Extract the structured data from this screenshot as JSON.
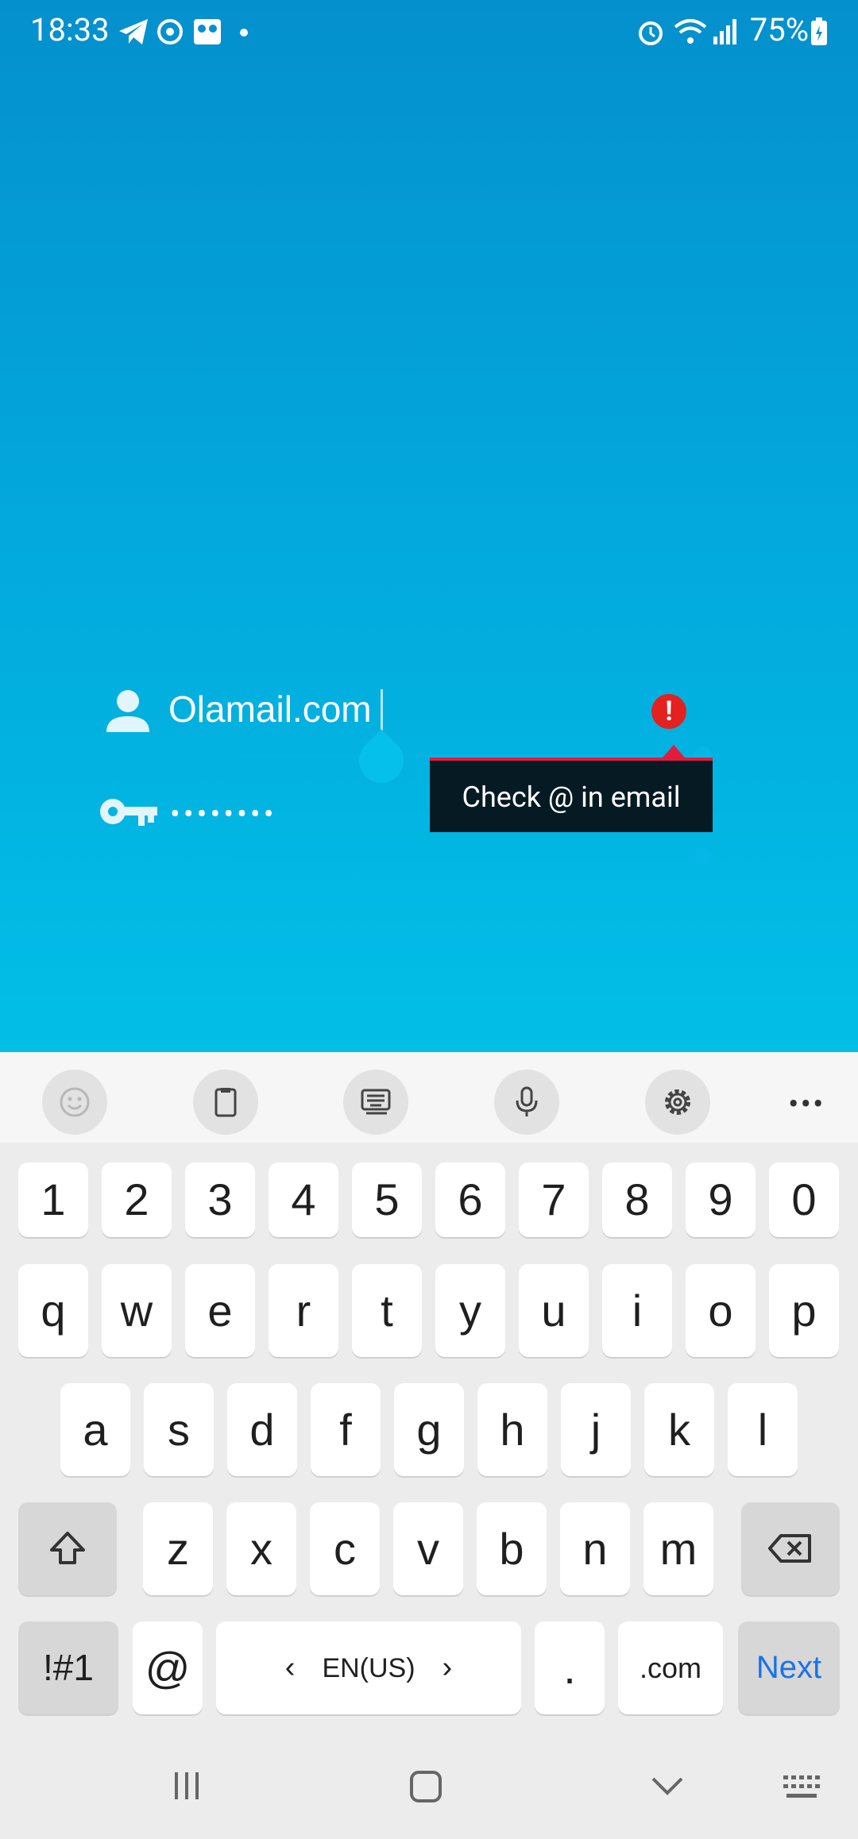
{
  "status_bar": {
    "time": "18:33",
    "battery": "75%"
  },
  "login": {
    "email_value": "Olamail.com",
    "password_dots": "••••••••",
    "error_tooltip": "Check @ in email"
  },
  "keyboard": {
    "toolbar": [
      "emoji-icon",
      "clipboard-icon",
      "keyboard-mode-icon",
      "microphone-icon",
      "gear-icon",
      "more-icon"
    ],
    "more_label": "•••",
    "number_row": [
      "1",
      "2",
      "3",
      "4",
      "5",
      "6",
      "7",
      "8",
      "9",
      "0"
    ],
    "row1": [
      "q",
      "w",
      "e",
      "r",
      "t",
      "y",
      "u",
      "i",
      "o",
      "p"
    ],
    "row2": [
      "a",
      "s",
      "d",
      "f",
      "g",
      "h",
      "j",
      "k",
      "l"
    ],
    "row3": [
      "z",
      "x",
      "c",
      "v",
      "b",
      "n",
      "m"
    ],
    "symbols_key": "!#1",
    "at_key": "@",
    "language": "EN(US)",
    "period_key": ".",
    "com_key": ".com",
    "next_key": "Next"
  },
  "colors": {
    "accent": "#1a73e8",
    "error": "#e3211f",
    "background_top": "#0490cd",
    "background_bottom": "#02bfe7"
  }
}
